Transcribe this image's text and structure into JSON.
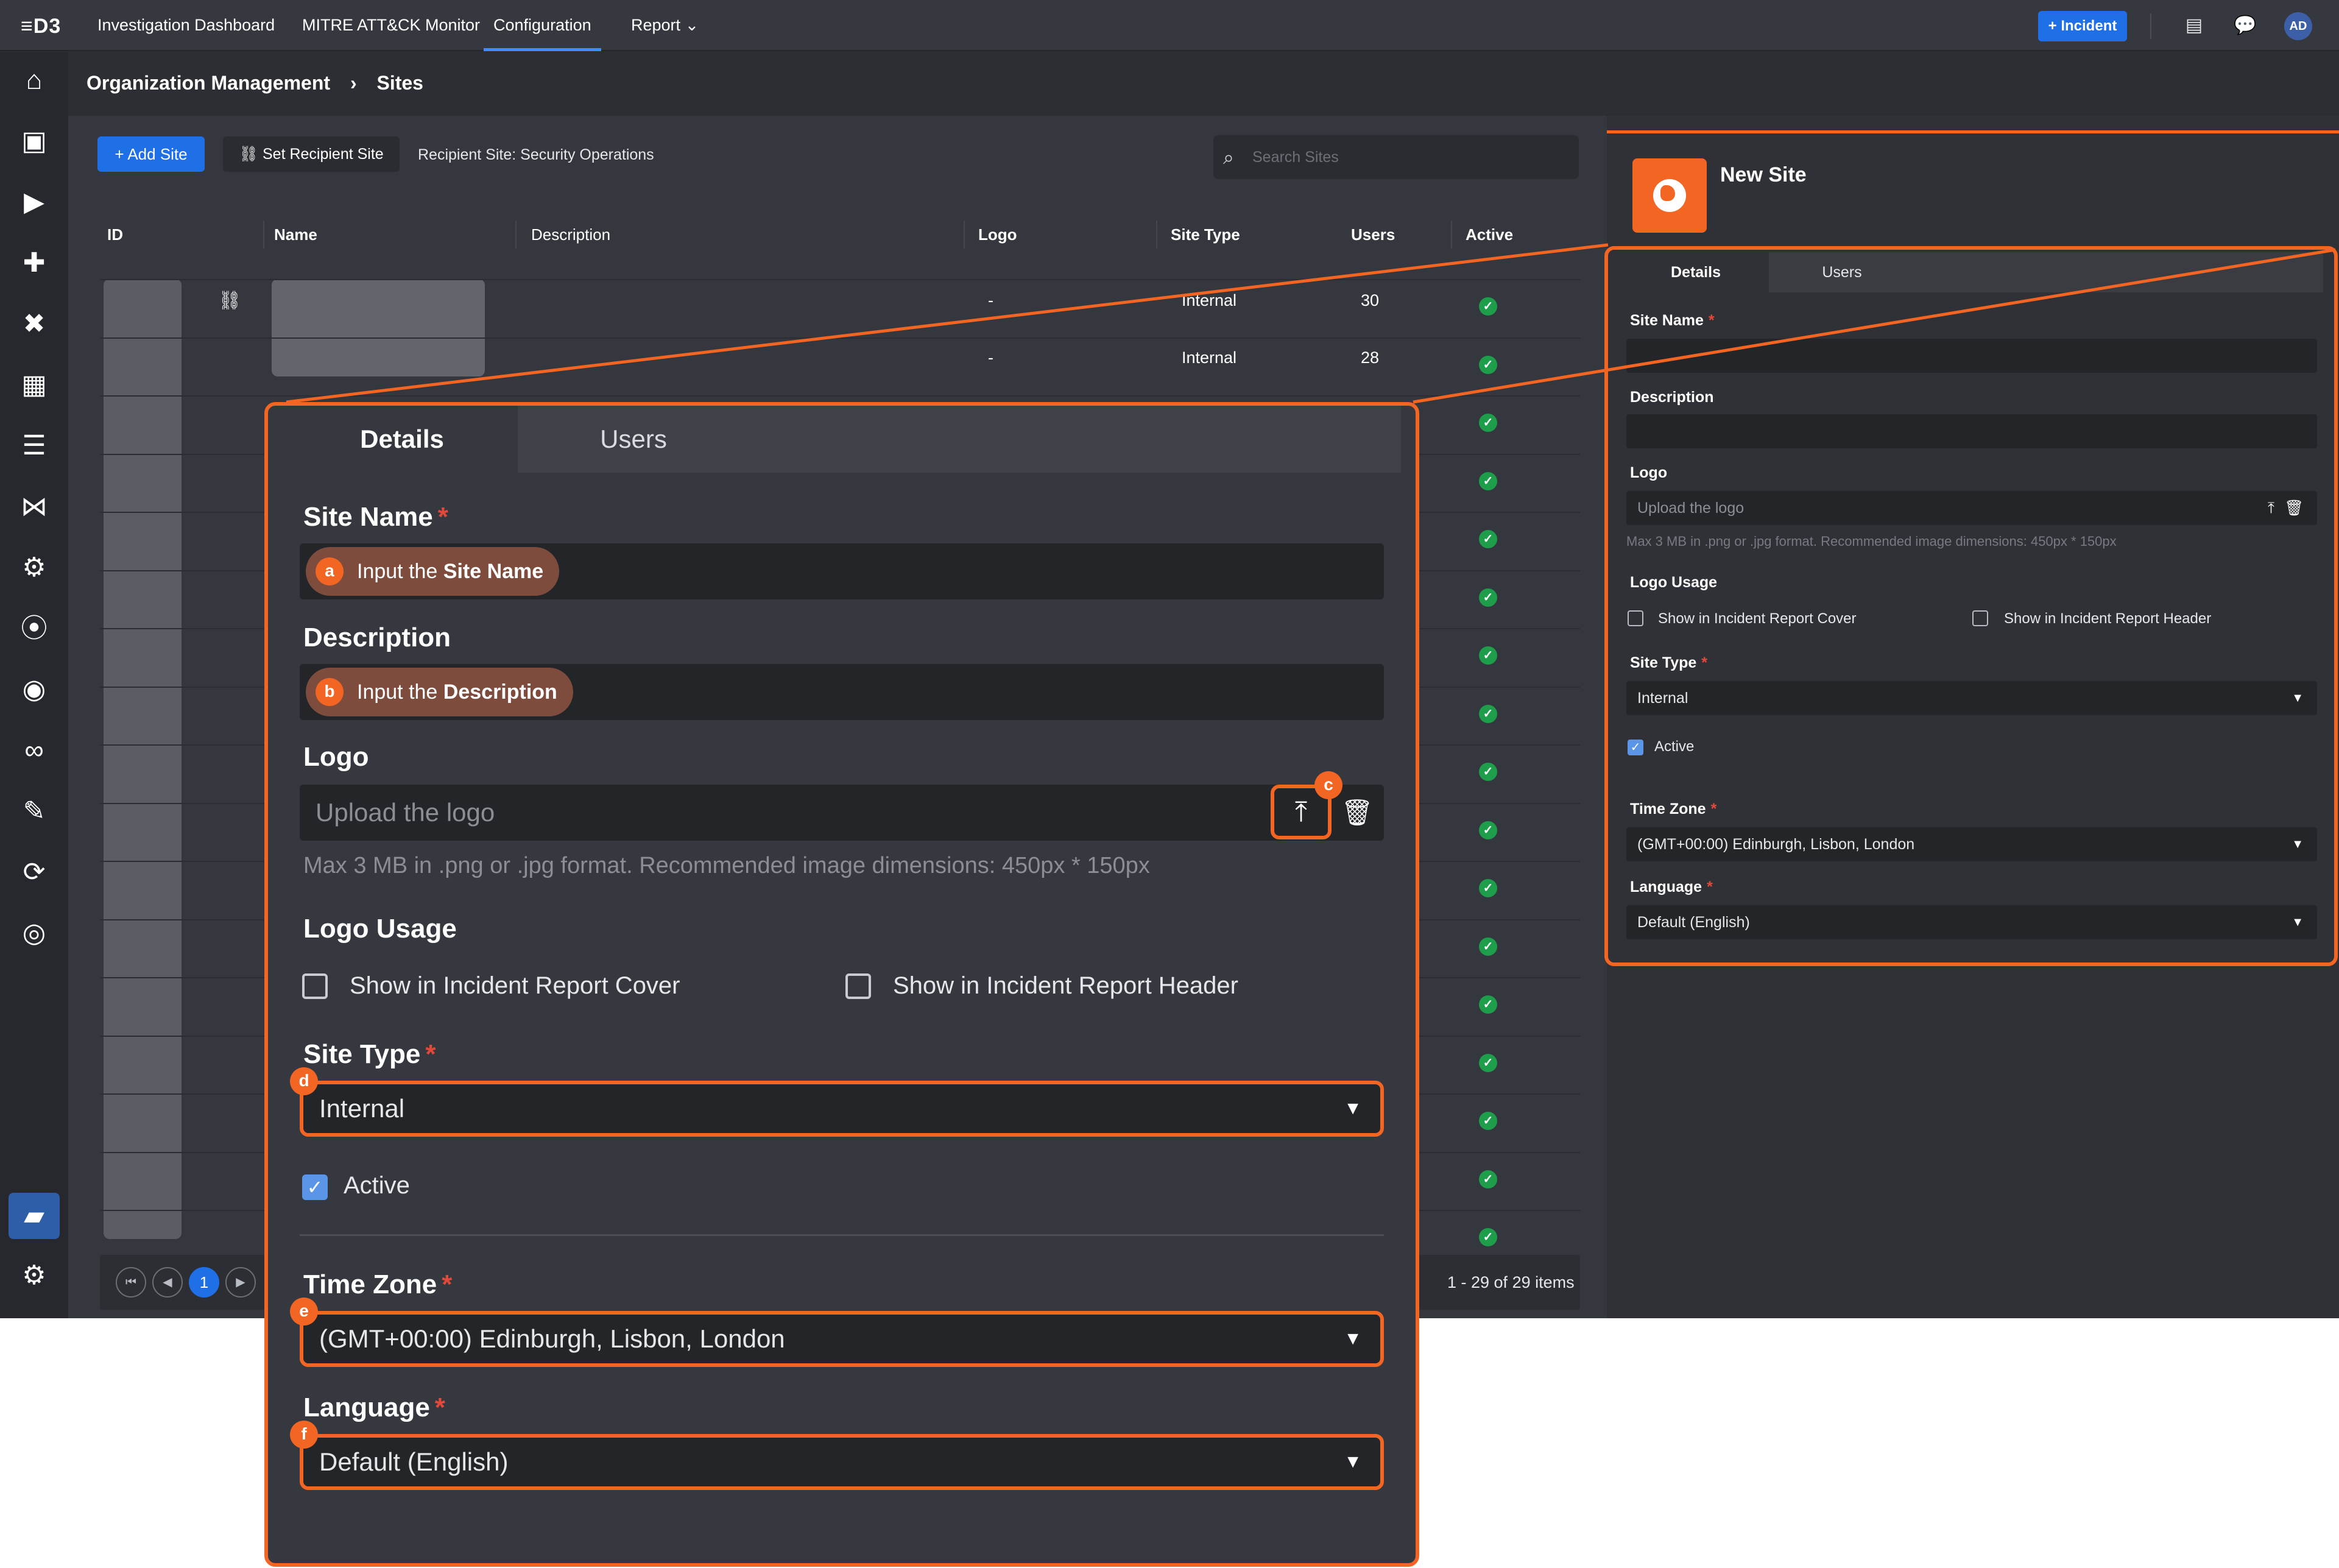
{
  "header": {
    "logo": "≡D3",
    "nav": [
      "Investigation Dashboard",
      "MITRE ATT&CK Monitor",
      "Configuration",
      "Report"
    ],
    "active_nav": "Configuration",
    "incident_button": "+ Incident",
    "avatar": "AD"
  },
  "breadcrumb": {
    "parent": "Organization Management",
    "current": "Sites"
  },
  "toolbar": {
    "add_site": "+ Add Site",
    "set_recipient": "Set Recipient Site",
    "recipient_text": "Recipient Site: Security Operations",
    "search_placeholder": "Search Sites"
  },
  "table": {
    "columns": [
      "ID",
      "Name",
      "Description",
      "Logo",
      "Site Type",
      "Users",
      "Active"
    ],
    "rows": [
      {
        "logo": "-",
        "type": "Internal",
        "users": "30"
      },
      {
        "logo": "-",
        "type": "Internal",
        "users": "28"
      }
    ],
    "active_rows": 17
  },
  "pagination": {
    "current_page": "1",
    "summary": "1 - 29 of 29 items"
  },
  "panel": {
    "title": "New Site",
    "tabs": [
      "Details",
      "Users"
    ],
    "active_tab": "Details",
    "site_name_label": "Site Name",
    "description_label": "Description",
    "logo_label": "Logo",
    "logo_placeholder": "Upload the logo",
    "logo_hint": "Max 3 MB in .png or .jpg format. Recommended image dimensions: 450px * 150px",
    "logo_usage_label": "Logo Usage",
    "logo_usage_cover": "Show in Incident Report Cover",
    "logo_usage_header": "Show in Incident Report Header",
    "site_type_label": "Site Type",
    "site_type_value": "Internal",
    "active_label": "Active",
    "active_checked": true,
    "time_zone_label": "Time Zone",
    "time_zone_value": "(GMT+00:00) Edinburgh, Lisbon, London",
    "language_label": "Language",
    "language_value": "Default (English)",
    "required_mark": "*"
  },
  "annotations": {
    "a_prefix": "Input the ",
    "a_bold": "Site Name",
    "b_prefix": "Input the ",
    "b_bold": "Description",
    "markers": [
      "a",
      "b",
      "c",
      "d",
      "e",
      "f"
    ]
  },
  "colors": {
    "accent_orange": "#f26522",
    "primary_blue": "#1f6fe6",
    "active_green": "#1e9e4a",
    "required_red": "#e2493a"
  },
  "icons": {
    "sidebar": [
      "home-icon",
      "incident-calendar-icon",
      "playbook-icon",
      "integration-puzzle-icon",
      "tools-icon",
      "schedule-calendar-icon",
      "database-icon",
      "graph-icon",
      "api-gear-icon",
      "broadcast-icon",
      "globe-person-icon",
      "binoculars-icon",
      "document-edit-icon",
      "sync-icon",
      "fingerprint-icon",
      "organization-folder-icon",
      "settings-gear-icon"
    ]
  }
}
